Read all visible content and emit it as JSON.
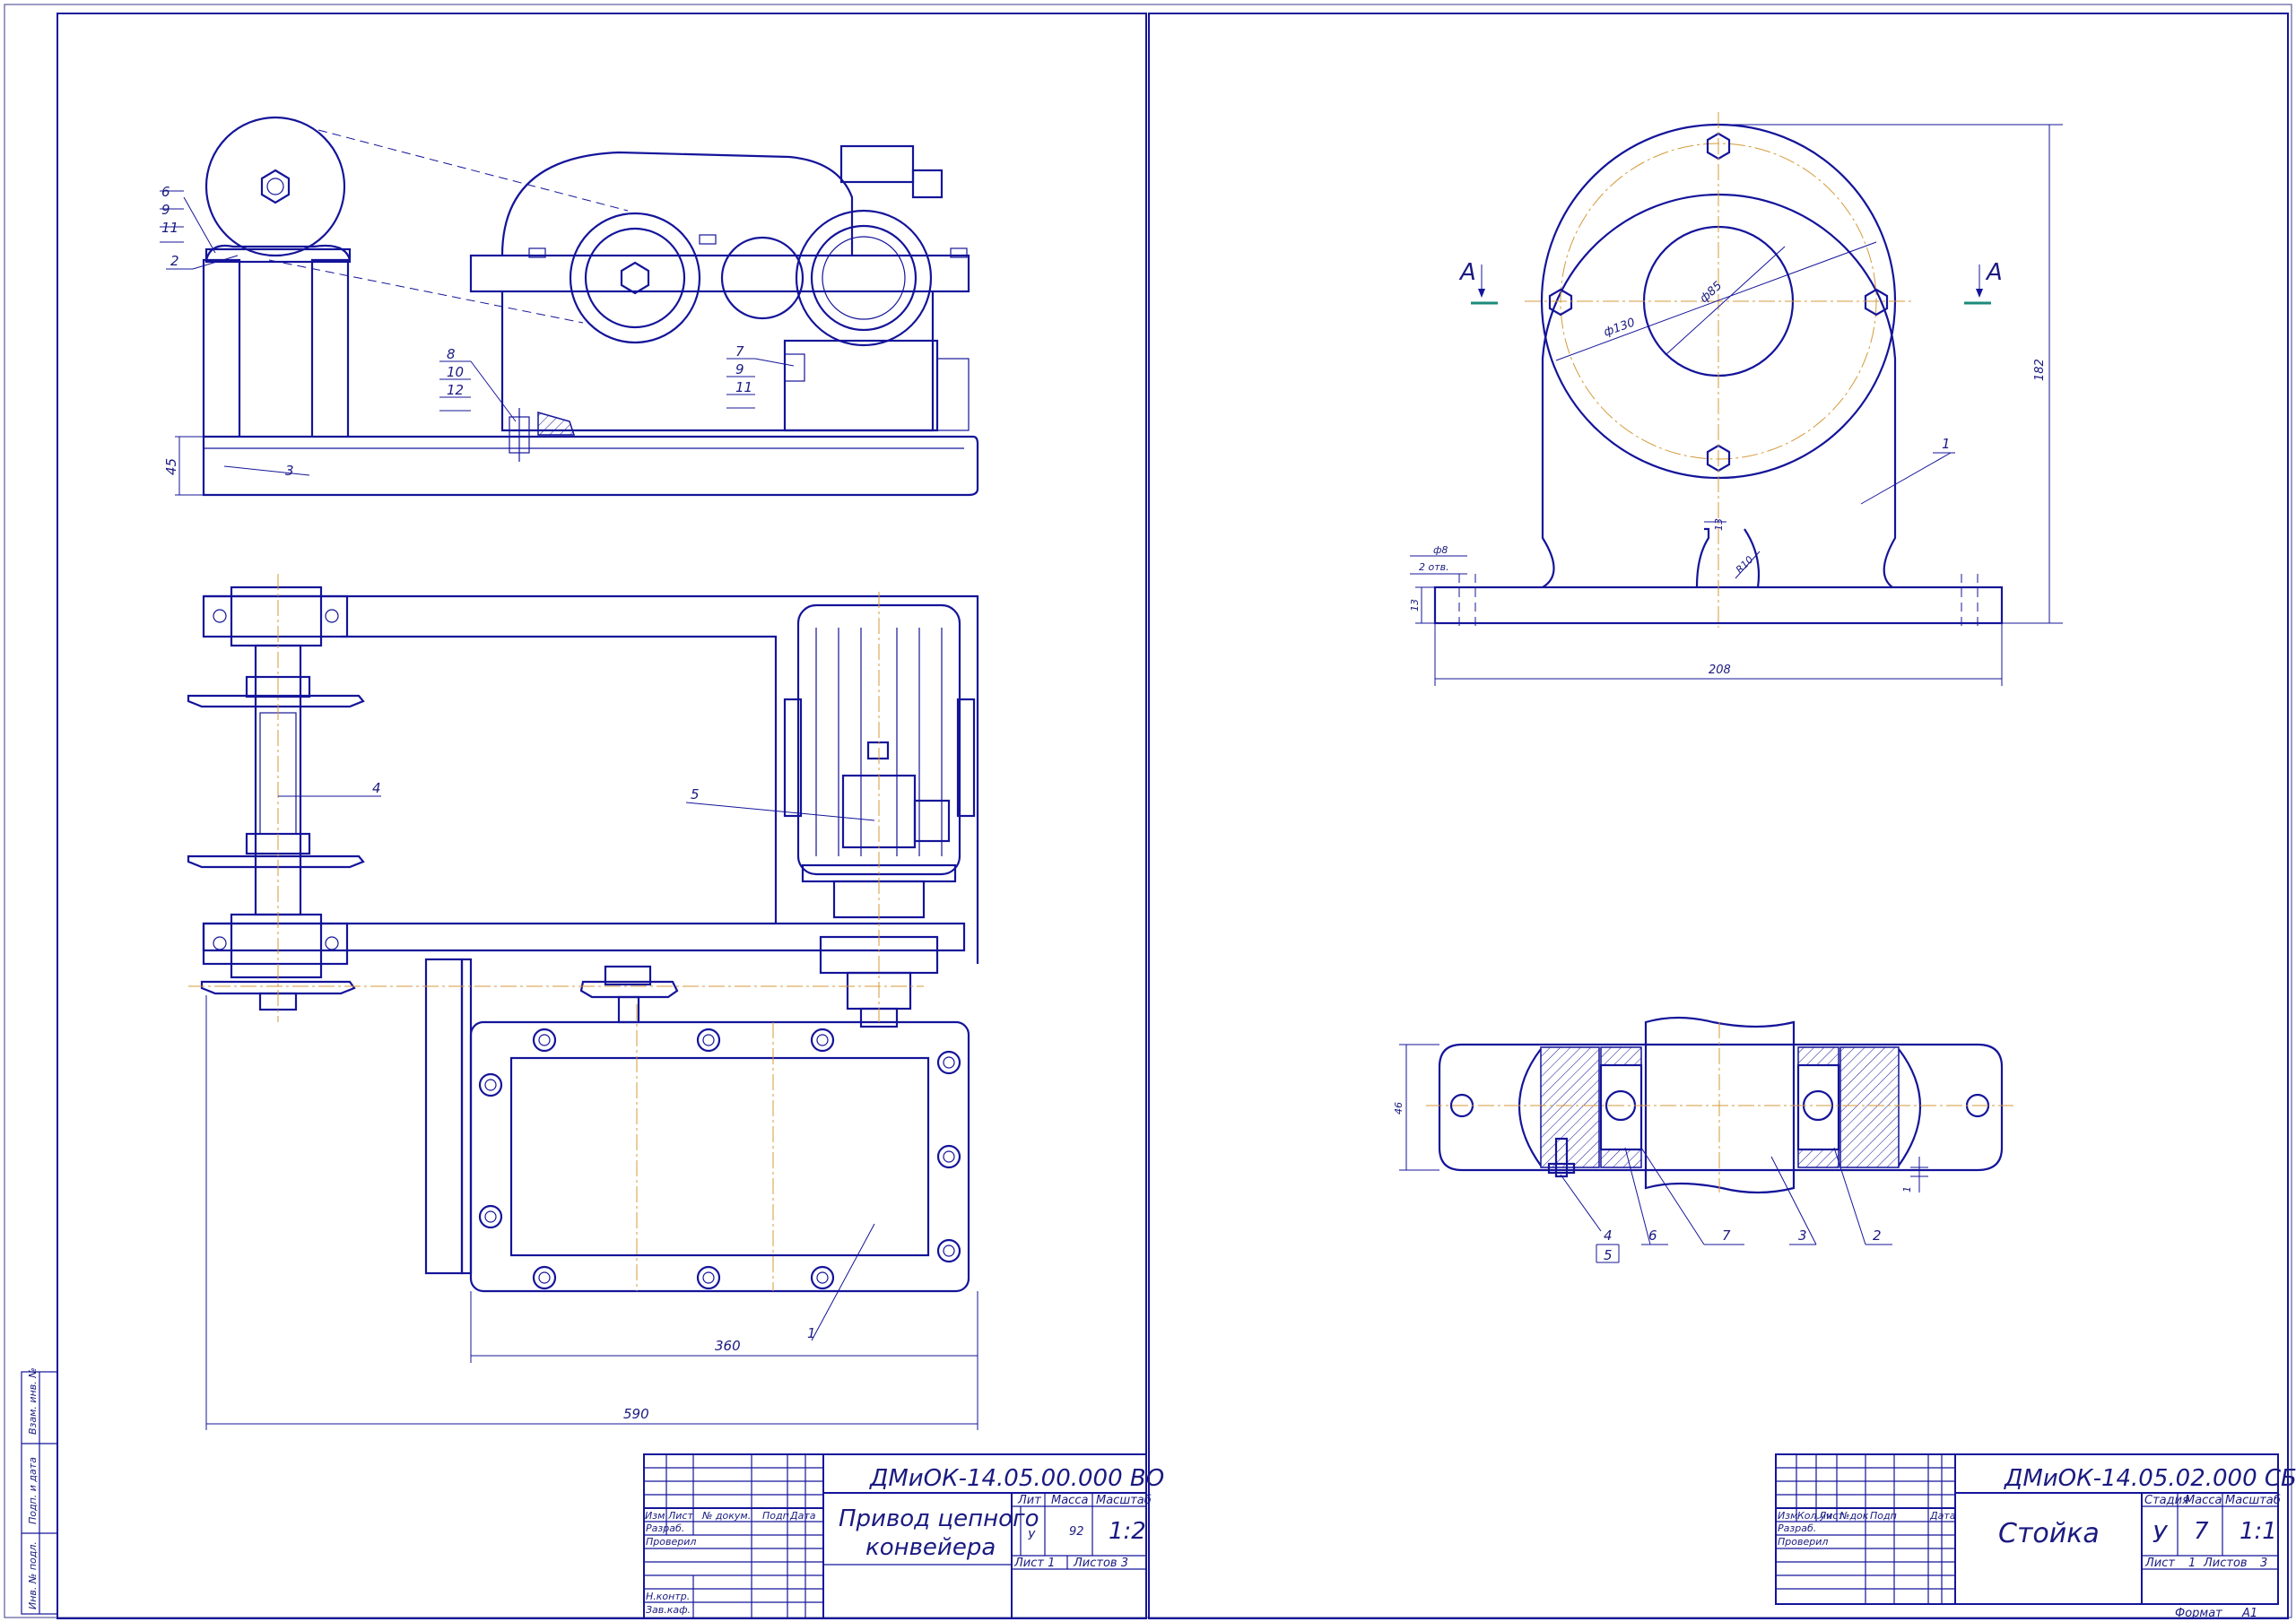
{
  "sheet1": {
    "doc_code": "ДМиОК-14.05.00.000 ВО",
    "title_line1": "Привод цепного",
    "title_line2": "конвейера",
    "lit_header": "Лит",
    "mass_header": "Масса",
    "scale_header": "Масштаб",
    "lit_value": "У",
    "mass_value": "92",
    "scale_value": "1:2",
    "sheet_label": "Лист 1",
    "sheets_label": "Листов 3",
    "cols": [
      "Изм",
      "Лист",
      "№ докум.",
      "Подп",
      "Дата"
    ],
    "rows": [
      "Разраб.",
      "Проверил",
      "Н.контр.",
      "Зав.каф."
    ],
    "dim_360": "360",
    "dim_590": "590",
    "dim_45": "45",
    "callouts": [
      "1",
      "2",
      "3",
      "4",
      "5",
      "6",
      "7",
      "8",
      "9",
      "10",
      "11",
      "12",
      "9",
      "11"
    ],
    "side_stamp": [
      "Инв. № подл.",
      "Подп. и дата",
      "Взам. инв. №"
    ]
  },
  "sheet2": {
    "doc_code": "ДМиОК-14.05.02.000 СБ",
    "title": "Стойка",
    "stage_header": "Стадия",
    "mass_header": "Масса",
    "scale_header": "Масштаб",
    "stage_value": "У",
    "mass_value": "7",
    "scale_value": "1:1",
    "sheet_label": "Лист",
    "sheet_num": "1",
    "sheets_label": "Листов",
    "sheets_num": "3",
    "cols": [
      "Изм",
      "Кол.уч",
      "Лист",
      "№док",
      "Подп",
      "Дата"
    ],
    "rows": [
      "Разраб.",
      "Проверил"
    ],
    "format_label": "Формат",
    "format_value": "А1",
    "section_mark": "А",
    "dims": {
      "d130": "ф130",
      "d85": "ф85",
      "h182": "182",
      "w208": "208",
      "h13": "13",
      "w13": "13",
      "r10": "R10",
      "hole": "ф8",
      "holes_count": "2 отв.",
      "h46": "46",
      "gap1": "1"
    },
    "callouts_top": [
      "1"
    ],
    "callouts_bottom": [
      "4",
      "5",
      "6",
      "7",
      "3",
      "2"
    ]
  }
}
